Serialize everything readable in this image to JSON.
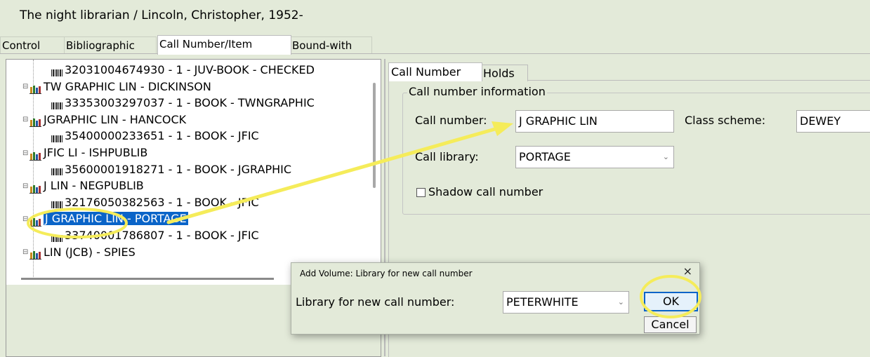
{
  "window": {
    "title": "The night librarian / Lincoln, Christopher, 1952-"
  },
  "main_tabs": [
    {
      "label": "Control"
    },
    {
      "label": "Bibliographic"
    },
    {
      "label": "Call Number/Item"
    },
    {
      "label": "Bound-with"
    }
  ],
  "tree": {
    "rows": [
      {
        "label": "32031004674930 - 1 - JUV-BOOK - CHECKED",
        "kind": "item",
        "icon": "barcode-icon"
      },
      {
        "label": "TW GRAPHIC LIN - DICKINSON",
        "kind": "callnum",
        "icon": "books-icon"
      },
      {
        "label": "33353003297037 - 1 - BOOK - TWNGRAPHIC",
        "kind": "item",
        "icon": "barcode-icon"
      },
      {
        "label": "JGRAPHIC LIN - HANCOCK",
        "kind": "callnum",
        "icon": "books-icon"
      },
      {
        "label": "35400000233651 - 1 - BOOK - JFIC",
        "kind": "item",
        "icon": "barcode-icon"
      },
      {
        "label": "JFIC LI - ISHPUBLIB",
        "kind": "callnum",
        "icon": "books-icon"
      },
      {
        "label": "35600001918271 - 1 - BOOK - JGRAPHIC",
        "kind": "item",
        "icon": "barcode-icon"
      },
      {
        "label": "J  LIN - NEGPUBLIB",
        "kind": "callnum",
        "icon": "books-icon"
      },
      {
        "label": "32176050382563 - 1 - BOOK - JFIC",
        "kind": "item",
        "icon": "barcode-icon"
      },
      {
        "label": "J GRAPHIC LIN - PORTAGE",
        "kind": "callnum",
        "icon": "books-icon",
        "selected": true
      },
      {
        "label": "33740001786807 - 1 - BOOK - JFIC",
        "kind": "item",
        "icon": "barcode-icon"
      },
      {
        "label": "LIN (JCB) - SPIES",
        "kind": "callnum",
        "icon": "books-icon"
      }
    ]
  },
  "sub_tabs": [
    {
      "label": "Call Number"
    },
    {
      "label": "Holds"
    }
  ],
  "call_number_info": {
    "legend": "Call number information",
    "call_number_label": "Call number:",
    "call_number_value": "J GRAPHIC LIN",
    "class_scheme_label": "Class scheme:",
    "class_scheme_value": "DEWEY",
    "call_library_label": "Call library:",
    "call_library_value": "PORTAGE",
    "shadow_label": "Shadow call number",
    "shadow_checked": false
  },
  "dialog": {
    "title": "Add Volume: Library for new call number",
    "close_glyph": "×",
    "library_label": "Library for new call number:",
    "library_value": "PETERWHITE",
    "ok_label": "OK",
    "cancel_label": "Cancel"
  },
  "colors": {
    "background": "#e3ead9",
    "selection": "#0a64c8",
    "annotation": "#f5ec5a"
  }
}
